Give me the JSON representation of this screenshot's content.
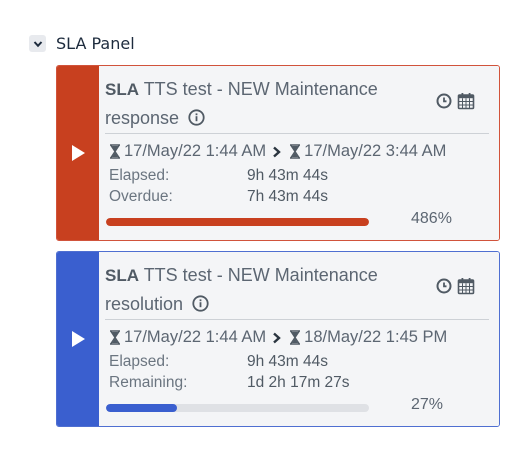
{
  "panel": {
    "title": "SLA Panel"
  },
  "cards": [
    {
      "accent": "#c8401f",
      "border": "#d1533b",
      "sla_label": "SLA",
      "title": "TTS test - NEW Maintenance response",
      "start": "17/May/22 1:44 AM",
      "end": "17/May/22 3:44 AM",
      "row1_label": "Elapsed:",
      "row1_value": "9h 43m 44s",
      "row2_label": "Overdue:",
      "row2_value": "7h 43m 44s",
      "progress_fill_fraction": 1.0,
      "percent": "486%"
    },
    {
      "accent": "#3a5fcf",
      "border": "#4f6fd1",
      "sla_label": "SLA",
      "title": "TTS test - NEW Maintenance resolution",
      "start": "17/May/22 1:44 AM",
      "end": "18/May/22 1:45 PM",
      "row1_label": "Elapsed:",
      "row1_value": "9h 43m 44s",
      "row2_label": "Remaining:",
      "row2_value": "1d 2h 17m 27s",
      "progress_fill_fraction": 0.27,
      "percent": "27%"
    }
  ],
  "icons": {
    "collapse": "chevron-down-icon",
    "play": "play-icon",
    "info": "info-icon",
    "clock": "clock-icon",
    "calendar": "calendar-icon",
    "hourglass": "hourglass-icon",
    "chevron": "chevron-right-icon"
  }
}
